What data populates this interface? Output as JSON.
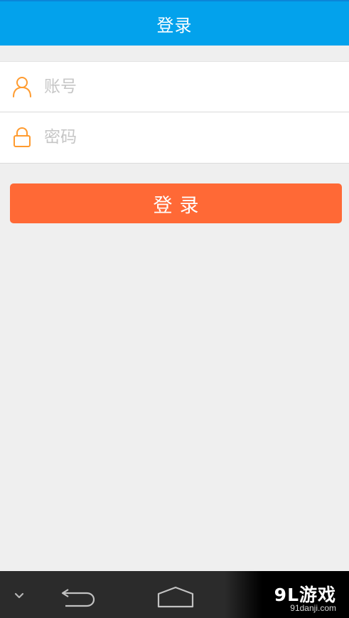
{
  "header": {
    "title": "登录"
  },
  "form": {
    "account": {
      "icon": "user-icon",
      "placeholder": "账号",
      "value": ""
    },
    "password": {
      "icon": "lock-icon",
      "placeholder": "密码",
      "value": ""
    }
  },
  "login_button": {
    "label": "登录"
  },
  "navbar": {
    "buttons": [
      "chevron-down-icon",
      "back-icon",
      "home-icon"
    ]
  },
  "watermark": {
    "logo": "9L游戏",
    "url": "91danji.com"
  },
  "colors": {
    "header_bg": "#03a2ec",
    "icon_accent": "#ff9b2f",
    "button_bg": "#ff6936",
    "page_bg": "#efefef",
    "navbar_bg": "#2b2b2b"
  }
}
